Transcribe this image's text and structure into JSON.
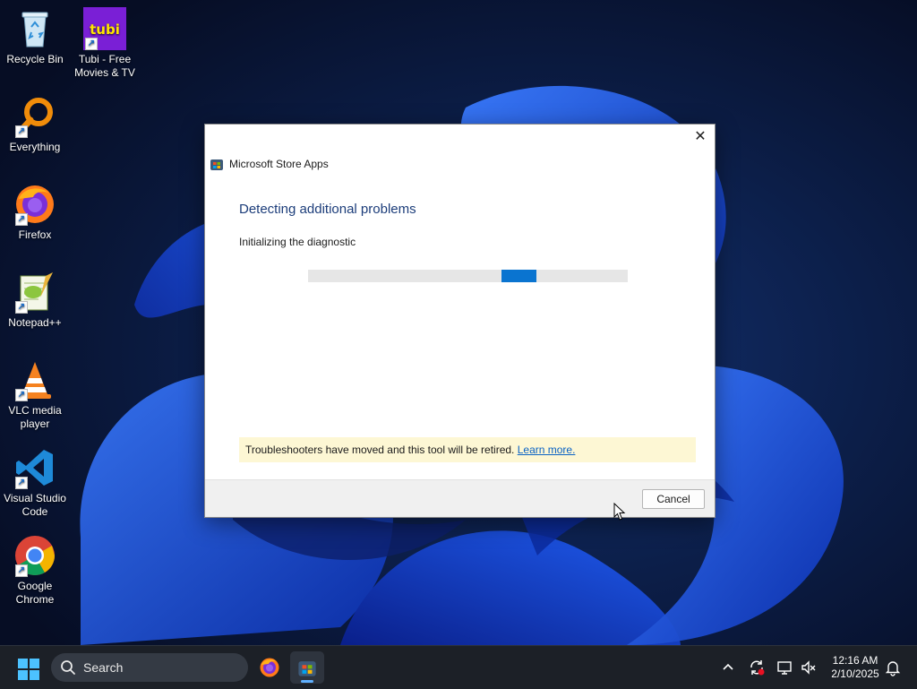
{
  "desktop": {
    "icons": [
      {
        "label": "Recycle Bin",
        "icon": "recycle-bin-icon"
      },
      {
        "label": "Tubi - Free Movies & TV",
        "icon": "tubi-icon",
        "logo_text": "tubi"
      },
      {
        "label": "Everything",
        "icon": "everything-search-icon"
      },
      {
        "label": "Firefox",
        "icon": "firefox-icon"
      },
      {
        "label": "Notepad++",
        "icon": "notepad-plus-plus-icon"
      },
      {
        "label": "VLC media player",
        "icon": "vlc-icon"
      },
      {
        "label": "Visual Studio Code",
        "icon": "vscode-icon"
      },
      {
        "label": "Google Chrome",
        "icon": "chrome-icon"
      }
    ]
  },
  "dialog": {
    "app_name": "Microsoft Store Apps",
    "heading": "Detecting additional problems",
    "status": "Initializing the diagnostic",
    "progress": "indeterminate",
    "notice_text": "Troubleshooters have moved and this tool will be retired.",
    "notice_link": "Learn more.",
    "cancel_label": "Cancel",
    "close_glyph": "✕"
  },
  "taskbar": {
    "search_placeholder": "Search",
    "apps": [
      "firefox-icon",
      "microsoft-store-icon"
    ],
    "time": "12:16 AM",
    "date": "2/10/2025"
  },
  "colors": {
    "heading": "#1c3d7a",
    "progress": "#0a74d0",
    "notice_bg": "#fdf7d4",
    "link": "#0a62c4",
    "taskbar": "#1c2027"
  }
}
